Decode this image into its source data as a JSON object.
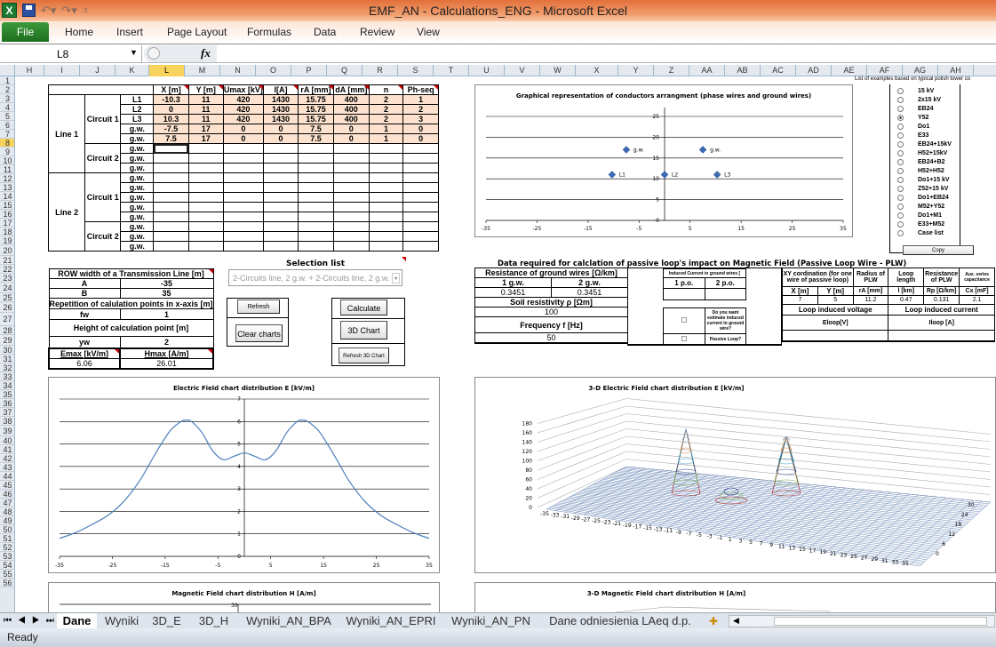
{
  "window": {
    "title": "EMF_AN - Calculations_ENG  -  Microsoft Excel"
  },
  "ribbon": {
    "file": "File",
    "tabs": [
      "Home",
      "Insert",
      "Page Layout",
      "Formulas",
      "Data",
      "Review",
      "View"
    ]
  },
  "formula_bar": {
    "name_box": "L8",
    "fx": "fx",
    "formula": ""
  },
  "columns": [
    "H",
    "I",
    "J",
    "K",
    "L",
    "M",
    "N",
    "O",
    "P",
    "Q",
    "R",
    "S",
    "T",
    "U",
    "V",
    "W",
    "X",
    "Y",
    "Z",
    "AA",
    "AB",
    "AC",
    "AD",
    "AE",
    "AF",
    "AG",
    "AH"
  ],
  "selected_column": "L",
  "selected_row": 8,
  "rows": [
    1,
    2,
    3,
    4,
    5,
    6,
    7,
    8,
    9,
    10,
    11,
    12,
    13,
    14,
    15,
    16,
    17,
    18,
    19,
    20,
    21,
    22,
    23,
    24,
    25,
    26,
    27,
    28,
    29,
    30,
    31,
    32,
    33,
    34,
    35,
    36,
    37,
    38,
    39,
    40,
    41,
    42,
    43,
    44,
    45,
    46,
    47,
    48,
    49,
    50,
    51,
    52,
    53,
    54,
    55,
    56
  ],
  "conductor_table": {
    "headers": [
      "X [m]",
      "Y [m]",
      "Umax [kV]",
      "I[A]",
      "rA [mm]",
      "dA [mm]",
      "n",
      "Ph-seq"
    ],
    "line1": "Line 1",
    "line2": "Line 2",
    "circuit1": "Circuit 1",
    "circuit2": "Circuit 2",
    "rows": [
      {
        "label": "L1",
        "values": [
          "-10.3",
          "11",
          "420",
          "1430",
          "15.75",
          "400",
          "2",
          "1"
        ]
      },
      {
        "label": "L2",
        "values": [
          "0",
          "11",
          "420",
          "1430",
          "15.75",
          "400",
          "2",
          "2"
        ]
      },
      {
        "label": "L3",
        "values": [
          "10.3",
          "11",
          "420",
          "1430",
          "15.75",
          "400",
          "2",
          "3"
        ]
      },
      {
        "label": "g.w.",
        "values": [
          "-7.5",
          "17",
          "0",
          "0",
          "7.5",
          "0",
          "1",
          "0"
        ]
      },
      {
        "label": "g.w.",
        "values": [
          "7.5",
          "17",
          "0",
          "0",
          "7.5",
          "0",
          "1",
          "0"
        ]
      },
      {
        "label": "g.w.",
        "values": [
          "",
          "",
          "",
          "",
          "",
          "",
          "",
          ""
        ]
      },
      {
        "label": "g.w.",
        "values": [
          "",
          "",
          "",
          "",
          "",
          "",
          "",
          ""
        ]
      },
      {
        "label": "g.w.",
        "values": [
          "",
          "",
          "",
          "",
          "",
          "",
          "",
          ""
        ]
      },
      {
        "label": "g.w.",
        "values": [
          "",
          "",
          "",
          "",
          "",
          "",
          "",
          ""
        ]
      },
      {
        "label": "g.w.",
        "values": [
          "",
          "",
          "",
          "",
          "",
          "",
          "",
          ""
        ]
      },
      {
        "label": "g.w.",
        "values": [
          "",
          "",
          "",
          "",
          "",
          "",
          "",
          ""
        ]
      },
      {
        "label": "g.w.",
        "values": [
          "",
          "",
          "",
          "",
          "",
          "",
          "",
          ""
        ]
      },
      {
        "label": "g.w.",
        "values": [
          "",
          "",
          "",
          "",
          "",
          "",
          "",
          ""
        ]
      },
      {
        "label": "g.w.",
        "values": [
          "",
          "",
          "",
          "",
          "",
          "",
          "",
          ""
        ]
      },
      {
        "label": "g.w.",
        "values": [
          "",
          "",
          "",
          "",
          "",
          "",
          "",
          ""
        ]
      },
      {
        "label": "g.w.",
        "values": [
          "",
          "",
          "",
          "",
          "",
          "",
          "",
          ""
        ]
      }
    ]
  },
  "row_table": {
    "title": "ROW width of a Transmission Line [m]",
    "a_label": "A",
    "a_value": "-35",
    "b_label": "B",
    "b_value": "35",
    "rep_title": "Repetition of calulation points in x-axis [m]",
    "fw_label": "fw",
    "fw_value": "1",
    "height_title": "Height of calculation point [m]",
    "yw_label": "yw",
    "yw_value": "2",
    "emax_label": "Emax [kV/m]",
    "hmax_label": "Hmax [A/m]",
    "emax_value": "6.06",
    "hmax_value": "26.01"
  },
  "selection": {
    "title": "Selection list",
    "value": "2-Circuits line, 2 g.w. + 2-Circuits line, 2 g.w.",
    "refresh": "Refresh",
    "clear_charts": "Clear charts",
    "calculate": "Calculate",
    "chart3d": "3D Chart",
    "refresh3d": "Refresh 3D Chart"
  },
  "plw": {
    "title": "Data required for calclation of passive loop's impact on Magnetic Field (Passive Loop Wire - PLW)",
    "res_title": "Resistance of ground wires [Ω/km]",
    "gw1": "1 g.w.",
    "gw2": "2 g.w.",
    "gw1_value": "0.3451",
    "gw2_value": "0.3451",
    "soil_label": "Soil resistivity ρ  [Ωm]",
    "soil_value": "100",
    "freq_label": "Frequency f [Hz]",
    "freq_value": "50",
    "induced_title": "Induced Current in ground wires [",
    "po1": "1 p.o.",
    "po2": "2 p.o.",
    "estimate_q": "Do you want estimate induced current in ground wire?",
    "passive_q": "Passive Loop?",
    "xy_title": "XY cordination (for one wire of passive loop)",
    "radius_title": "Radius of PLW",
    "loop_len_title": "Loop length",
    "res_plw_title": "Resistance of PLW",
    "aux_title": "Aux. series capacitance",
    "x_label": "X [m]",
    "y_label": "Y [m]",
    "ra_label": "rA [mm]",
    "l_label": "l [km]",
    "rp_label": "Rp [Ω/km]",
    "cx_label": "Cx [mF]",
    "x_value": "7",
    "y_value": "5",
    "ra_value": "11.2",
    "l_value": "0.47",
    "rp_value": "0.131",
    "cx_value": "2.1",
    "volt_title": "Loop induced voltage",
    "curr_title": "Loop induced current",
    "volt_label": "Eloop[V]",
    "curr_label": "Iloop [A]"
  },
  "examples": {
    "title": "List of examples based on typical polish tower co",
    "items": [
      "15 kV",
      "2x15 kV",
      "EB24",
      "Y52",
      "Do1",
      "E33",
      "EB24+15kV",
      "H52+15kV",
      "EB24+B2",
      "H52+H52",
      "Do1+15 kV",
      "Z52+15 kV",
      "Do1+EB24",
      "M52+Y52",
      "Do1+M1",
      "E33+M52",
      "Case list"
    ],
    "selected": "Y52",
    "copy": "Copy"
  },
  "chart_data": [
    {
      "type": "scatter",
      "title": "Graphical representation of conductors  arrangment (phase wires and ground wires)",
      "xlim": [
        -35,
        35
      ],
      "ylim": [
        0,
        25
      ],
      "xticks": [
        -35,
        -25,
        -15,
        -5,
        5,
        15,
        25,
        35
      ],
      "yticks": [
        0,
        5,
        10,
        15,
        20,
        25
      ],
      "points": [
        {
          "x": -10.3,
          "y": 11,
          "label": "L1"
        },
        {
          "x": 0,
          "y": 11,
          "label": "L2"
        },
        {
          "x": 10.3,
          "y": 11,
          "label": "L3"
        },
        {
          "x": -7.5,
          "y": 17,
          "label": "g.w."
        },
        {
          "x": 7.5,
          "y": 17,
          "label": "g.w."
        }
      ],
      "grid": true
    },
    {
      "type": "line",
      "title": "Electric Field chart distribution  E [kV/m]",
      "xlim": [
        -35,
        35
      ],
      "ylim": [
        0,
        7
      ],
      "xticks": [
        -35,
        -25,
        -15,
        -5,
        5,
        15,
        25,
        35
      ],
      "yticks": [
        0,
        1,
        2,
        3,
        4,
        5,
        6,
        7
      ],
      "x": [
        -35,
        -32,
        -29,
        -26,
        -23,
        -20,
        -18,
        -16,
        -14,
        -12,
        -11,
        -10,
        -8,
        -6,
        -4,
        -2,
        0,
        2,
        4,
        6,
        8,
        10,
        11,
        12,
        14,
        16,
        18,
        20,
        23,
        26,
        29,
        32,
        35
      ],
      "y": [
        0.8,
        1.05,
        1.4,
        1.8,
        2.4,
        3.3,
        4.1,
        4.9,
        5.6,
        6.0,
        6.06,
        6.0,
        5.5,
        4.7,
        4.3,
        4.45,
        4.6,
        4.45,
        4.3,
        4.7,
        5.5,
        6.0,
        6.06,
        6.0,
        5.6,
        4.9,
        4.1,
        3.3,
        2.4,
        1.8,
        1.4,
        1.05,
        0.8
      ],
      "grid": true
    },
    {
      "type": "area",
      "title": "3-D Electric Field chart distribution  E [kV/m]",
      "zticks": [
        0,
        20,
        40,
        60,
        80,
        100,
        120,
        140,
        160,
        180
      ],
      "xticks": [
        -35,
        -33,
        -31,
        -29,
        -27,
        -25,
        -23,
        -21,
        -19,
        -17,
        -15,
        -13,
        -11,
        -9,
        -7,
        -5,
        -3,
        -1,
        1,
        3,
        5,
        7,
        9,
        11,
        13,
        15,
        17,
        19,
        21,
        23,
        25,
        27,
        29,
        31,
        33,
        35
      ],
      "yticks": [
        0,
        6,
        12,
        18,
        24,
        30
      ]
    },
    {
      "type": "line",
      "title": "Magnetic Field chart distribution  H [A/m]",
      "yticks": [
        30
      ]
    },
    {
      "type": "area",
      "title": "3-D Magnetic Field chart distribution  H [A/m]"
    }
  ],
  "sheet_tabs": [
    "Dane",
    "Wyniki",
    "3D_E",
    "3D_H",
    "Wyniki_AN_BPA",
    "Wyniki_AN_EPRI",
    "Wyniki_AN_PN",
    "Dane odniesienia LAeq d.p."
  ],
  "active_tab": "Dane",
  "status": "Ready"
}
